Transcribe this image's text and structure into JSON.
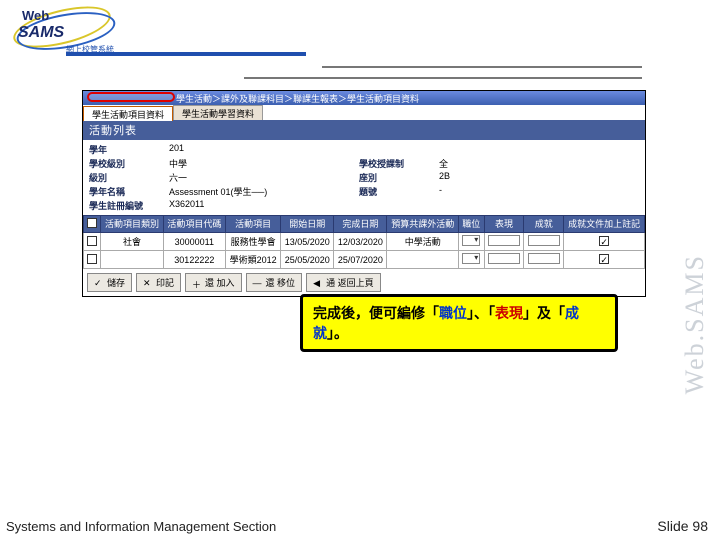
{
  "logo": {
    "line1": "Web",
    "line2": "SAMS",
    "sub": "網上校管系統"
  },
  "header": {
    "breadcrumb": "學生活動＞課外及聯課科目＞聯課生報表＞學生活動項目資料"
  },
  "tabs": [
    "學生活動項目資料",
    "學生活動學習資料"
  ],
  "section_title": "活動列表",
  "kv": {
    "rows": [
      {
        "l1": "學年",
        "v1": "201",
        "l2": "",
        "v2": ""
      },
      {
        "l1": "學校級別",
        "v1": "中學",
        "l2": "學校授課制",
        "v2": "全"
      },
      {
        "l1": "級別",
        "v1": "六一",
        "l2": "座別",
        "v2": "2B"
      },
      {
        "l1": "學年名稱",
        "v1": "Assessment 01(學生──)",
        "l2": "題號",
        "v2": "-"
      },
      {
        "l1": "學生註冊編號",
        "v1": "X362011",
        "l2": "",
        "v2": ""
      }
    ]
  },
  "table": {
    "cols": [
      "",
      "活動項目類別",
      "活動項目代碼",
      "活動項目",
      "開始日期",
      "完成日期",
      "預算共課外活動",
      "職位",
      "表現",
      "成就",
      "成就文件加上註記"
    ],
    "rows": [
      {
        "chk": false,
        "cat": "社會",
        "code": "30000011",
        "prog": "服務性學會",
        "start": "13/05/2020",
        "end": "12/03/2020",
        "extra": "中學活動",
        "pos_sel": true,
        "perf_txt": true,
        "ach_txt": true,
        "note_chk": true
      },
      {
        "chk": false,
        "cat": "",
        "code": "30122222",
        "prog": "學術類2012",
        "start": "25/05/2020",
        "end": "25/07/2020",
        "extra": "",
        "pos_sel": true,
        "perf_txt": true,
        "ach_txt": true,
        "note_chk": true
      }
    ]
  },
  "buttons": [
    "儲存",
    "印記",
    "還 加入",
    "還 移位",
    "通 返回上頁"
  ],
  "callout": {
    "t1": "完成後，便可編修「",
    "a1": "職位",
    "t2": "」、「",
    "a2": "表現",
    "t3": "」及「",
    "a3": "成就",
    "t4": "」。"
  },
  "side": "Web.SAMS",
  "footer_left": "Systems and Information Management Section",
  "footer_right_label": "Slide ",
  "footer_right_num": "98"
}
